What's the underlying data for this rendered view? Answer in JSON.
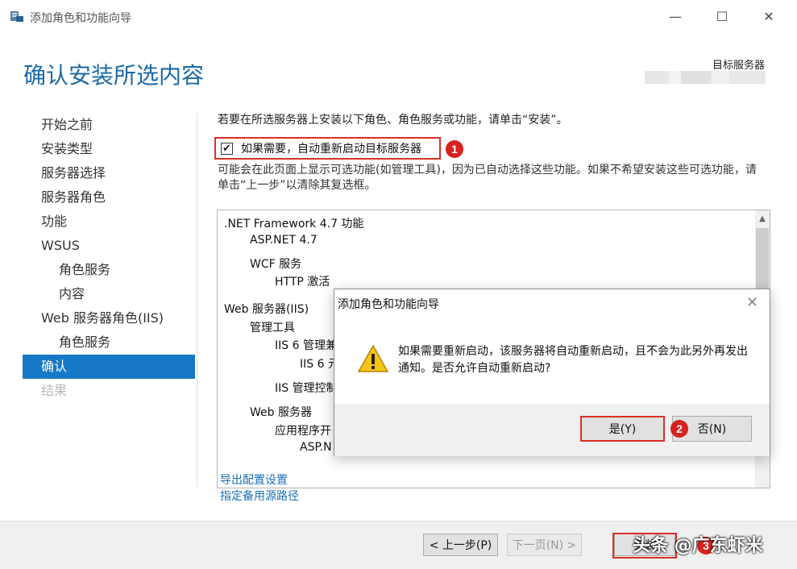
{
  "window": {
    "title": "添加角色和功能向导",
    "min_glyph": "—",
    "max_glyph": "☐",
    "close_glyph": "✕"
  },
  "header": {
    "page_title": "确认安装所选内容",
    "dest_server_label": "目标服务器"
  },
  "nav": {
    "items": [
      {
        "label": "开始之前"
      },
      {
        "label": "安装类型"
      },
      {
        "label": "服务器选择"
      },
      {
        "label": "服务器角色"
      },
      {
        "label": "功能"
      },
      {
        "label": "WSUS"
      },
      {
        "label": "角色服务"
      },
      {
        "label": "内容"
      },
      {
        "label": "Web 服务器角色(IIS)"
      },
      {
        "label": "角色服务"
      },
      {
        "label": "确认"
      },
      {
        "label": "结果"
      }
    ]
  },
  "content": {
    "intro": "若要在所选服务器上安装以下角色、角色服务或功能，请单击“安装”。",
    "restart_checkbox_label": "如果需要，自动重新启动目标服务器",
    "restart_checked_glyph": "✔",
    "note": "可能会在此页面上显示可选功能(如管理工具)，因为已自动选择这些功能。如果不希望安装这些可选功能，请单击“上一步”以清除其复选框。",
    "features": [
      ".NET Framework 4.7 功能",
      "ASP.NET 4.7",
      "WCF 服务",
      "HTTP 激活",
      "Web 服务器(IIS)",
      "管理工具",
      "IIS 6 管理兼",
      "IIS 6 元",
      "IIS 管理控制",
      "Web 服务器",
      "应用程序开",
      "ASP.N"
    ],
    "export_link": "导出配置设置",
    "alt_source_link": "指定备用源路径"
  },
  "badges": {
    "one": "1",
    "two": "2",
    "three": "3"
  },
  "footer": {
    "prev_label": "< 上一步(P)",
    "next_label": "下一页(N) >",
    "install_label": "安装",
    "watermark": "头条 @广东虾米"
  },
  "dialog": {
    "title": "添加角色和功能向导",
    "close_glyph": "✕",
    "message": "如果需要重新启动，该服务器将自动重新启动，且不会为此另外再发出通知。是否允许自动重新启动?",
    "yes_label": "是(Y)",
    "no_label": "否(N)"
  },
  "colors": {
    "accent": "#1778c7",
    "title_blue": "#1b6aa6",
    "highlight_red": "#d93025"
  }
}
